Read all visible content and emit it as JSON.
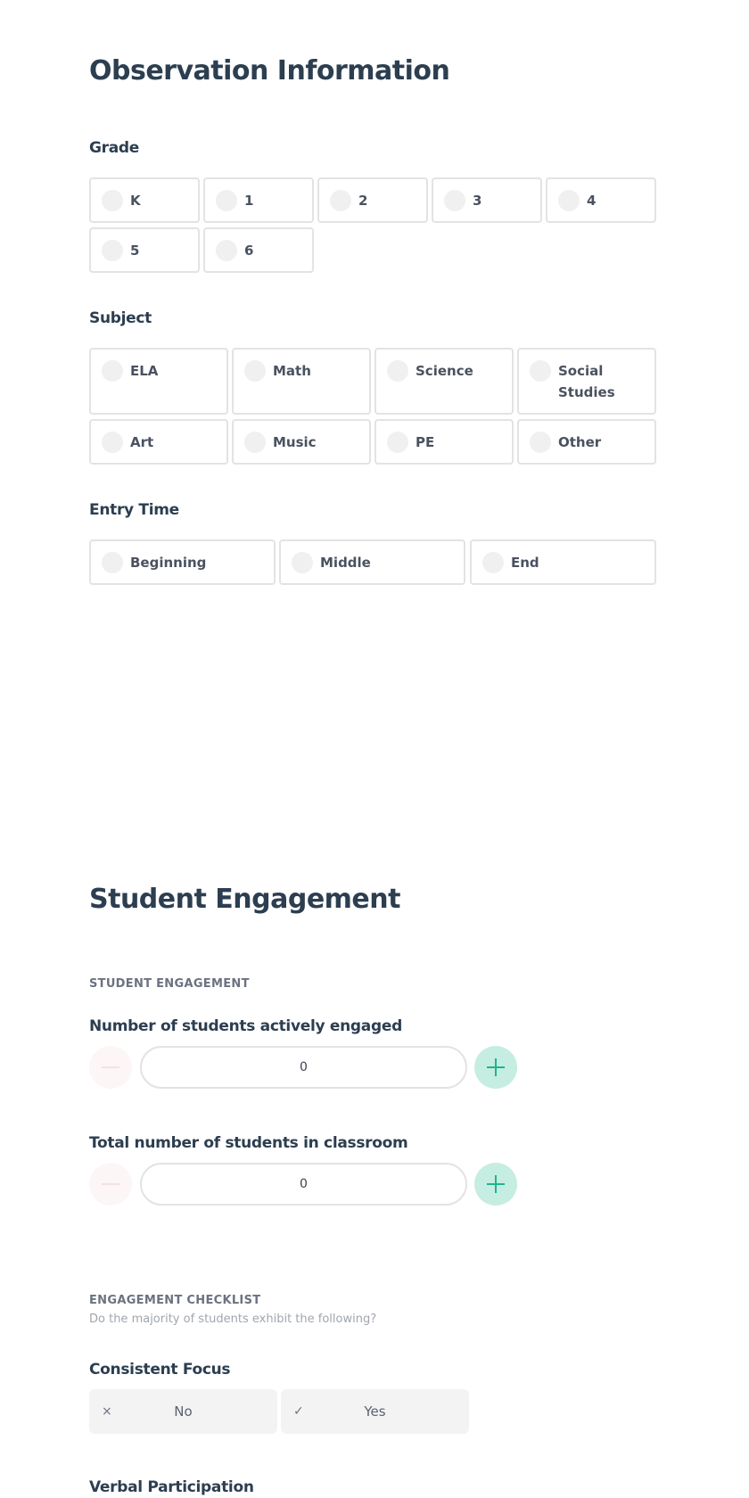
{
  "observation": {
    "title": "Observation Information",
    "grade": {
      "label": "Grade",
      "options": [
        "K",
        "1",
        "2",
        "3",
        "4",
        "5",
        "6"
      ]
    },
    "subject": {
      "label": "Subject",
      "options": [
        "ELA",
        "Math",
        "Science",
        "Social Studies",
        "Art",
        "Music",
        "PE",
        "Other"
      ]
    },
    "entry_time": {
      "label": "Entry Time",
      "options": [
        "Beginning",
        "Middle",
        "End"
      ]
    }
  },
  "engagement": {
    "title": "Student Engagement",
    "section_label": "STUDENT ENGAGEMENT",
    "actively_engaged": {
      "label": "Number of students actively engaged",
      "value": "0"
    },
    "total_students": {
      "label": "Total number of students in classroom",
      "value": "0"
    },
    "checklist": {
      "label": "ENGAGEMENT CHECKLIST",
      "subtitle": "Do the majority of students exhibit the following?",
      "items": [
        {
          "label": "Consistent Focus",
          "no": "No",
          "yes": "Yes",
          "no_icon": "×",
          "yes_icon": "✓"
        },
        {
          "label": "Verbal Participation"
        }
      ]
    }
  },
  "colors": {
    "heading": "#2c3e50",
    "accent": "#1fb48e",
    "accent_bg": "#c6ede2",
    "border": "#e3e3e3"
  }
}
